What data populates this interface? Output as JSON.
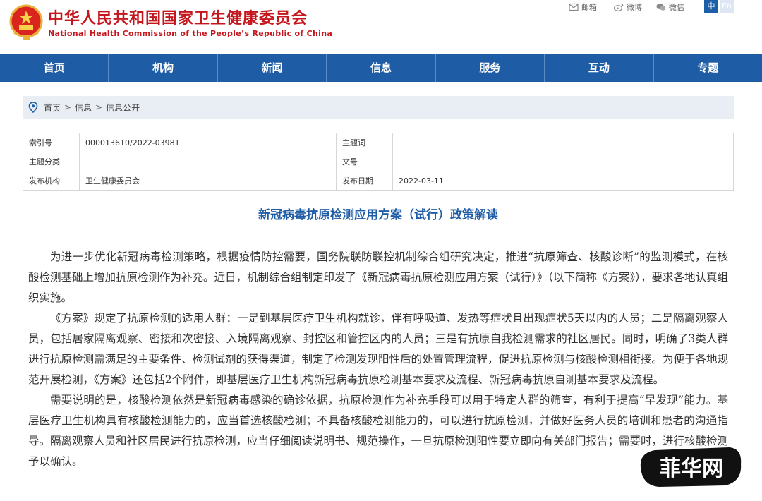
{
  "header": {
    "title_cn": "中华人民共和国国家卫生健康委员会",
    "title_en": "National Health Commission of the People’s Republic of China",
    "social": {
      "mail": "邮箱",
      "weibo": "微博",
      "wechat": "微信"
    },
    "lang": {
      "zh": "中",
      "en": "En"
    }
  },
  "nav": {
    "items": [
      "首页",
      "机构",
      "新闻",
      "信息",
      "服务",
      "互动",
      "专题"
    ]
  },
  "breadcrumb": {
    "home": "首页",
    "sep": ">",
    "level1": "信息",
    "level2": "信息公开"
  },
  "info": {
    "index_label": "索引号",
    "index_value": "000013610/2022-03981",
    "subject_word_label": "主题词",
    "subject_word_value": "",
    "category_label": "主题分类",
    "category_value": "",
    "doc_no_label": "文号",
    "doc_no_value": "",
    "publisher_label": "发布机构",
    "publisher_value": "卫生健康委员会",
    "date_label": "发布日期",
    "date_value": "2022-03-11"
  },
  "article": {
    "title": "新冠病毒抗原检测应用方案（试行）政策解读",
    "paragraphs": [
      "为进一步优化新冠病毒检测策略，根据疫情防控需要，国务院联防联控机制综合组研究决定，推进“抗原筛查、核酸诊断”的监测模式，在核酸检测基础上增加抗原检测作为补充。近日，机制综合组制定印发了《新冠病毒抗原检测应用方案（试行）》（以下简称《方案》），要求各地认真组织实施。",
      "《方案》规定了抗原检测的适用人群：一是到基层医疗卫生机构就诊，伴有呼吸道、发热等症状且出现症状5天以内的人员；二是隔离观察人员，包括居家隔离观察、密接和次密接、入境隔离观察、封控区和管控区内的人员；三是有抗原自我检测需求的社区居民。同时，明确了3类人群进行抗原检测需满足的主要条件、检测试剂的获得渠道，制定了检测发现阳性后的处置管理流程，促进抗原检测与核酸检测相衔接。为便于各地规范开展检测，《方案》还包括2个附件，即基层医疗卫生机构新冠病毒抗原检测基本要求及流程、新冠病毒抗原自测基本要求及流程。",
      "需要说明的是，核酸检测依然是新冠病毒感染的确诊依据，抗原检测作为补充手段可以用于特定人群的筛查，有利于提高“早发现”能力。基层医疗卫生机构具有核酸检测能力的，应当首选核酸检测；不具备核酸检测能力的，可以进行抗原检测，并做好医务人员的培训和患者的沟通指导。隔离观察人员和社区居民进行抗原检测，应当仔细阅读说明书、规范操作，一旦抗原检测阳性要立即向有关部门报告；需要时，进行核酸检测予以确认。"
    ]
  },
  "watermark": {
    "text": "菲华网"
  },
  "colors": {
    "brand_red": "#c4161c",
    "nav_blue": "#1f5ca6",
    "breadcrumb_bg": "#e9eef4"
  }
}
